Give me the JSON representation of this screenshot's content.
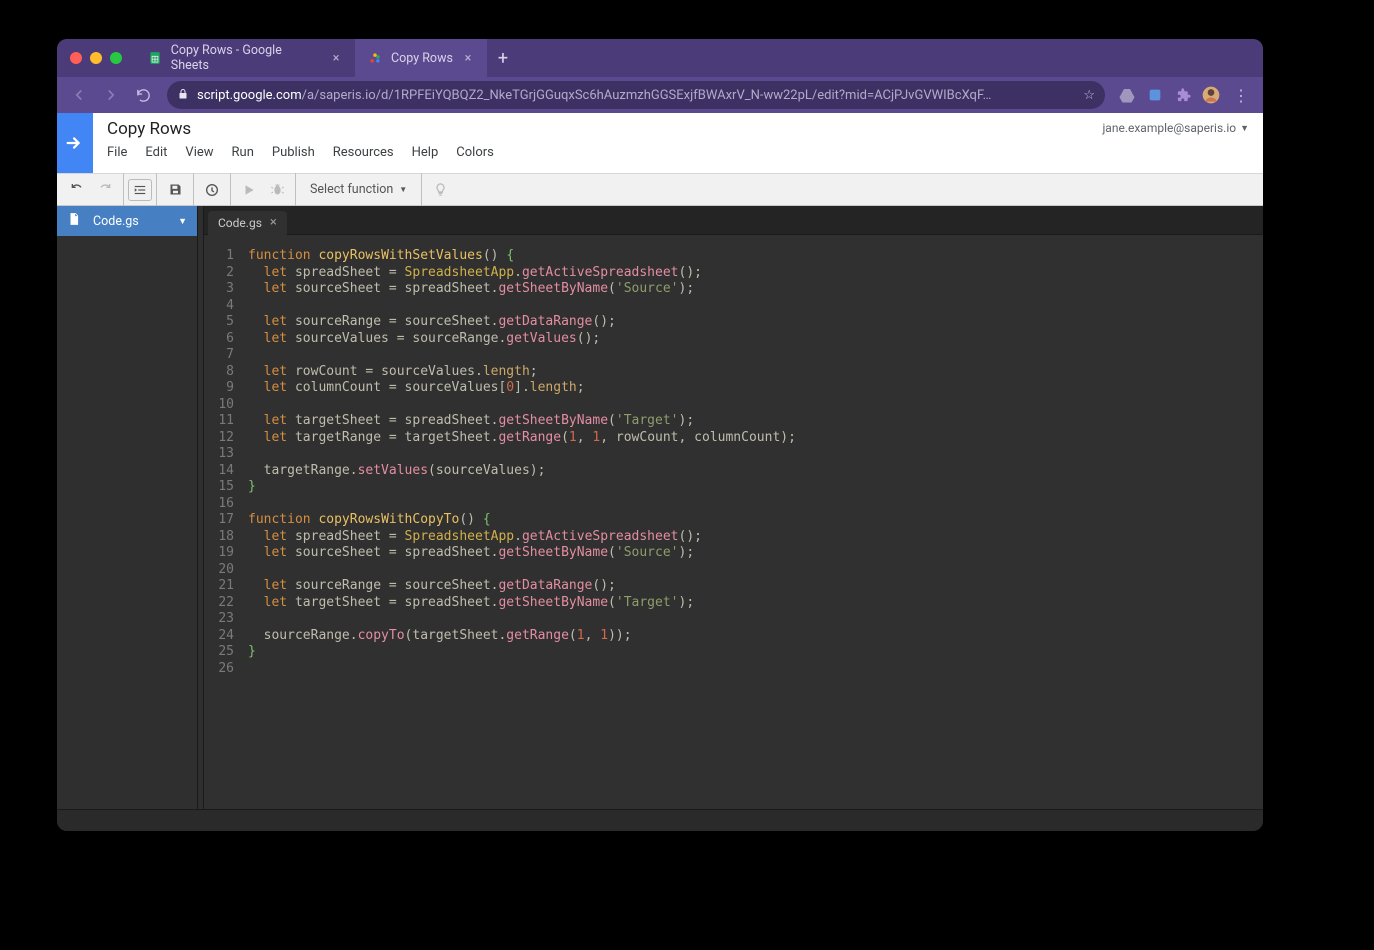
{
  "browser": {
    "tabs": [
      {
        "label": "Copy Rows - Google Sheets",
        "active": false,
        "icon": "sheets"
      },
      {
        "label": "Copy Rows",
        "active": true,
        "icon": "apps-script"
      }
    ],
    "url_host": "script.google.com",
    "url_path": "/a/saperis.io/d/1RPFEiYQBQZ2_NkeTGrjGGuqxSc6hAuzmzhGGSExjfBWAxrV_N-ww22pL/edit?mid=ACjPJvGVWIBcXqF…"
  },
  "app": {
    "title": "Copy Rows",
    "account": "jane.example@saperis.io",
    "menu": [
      "File",
      "Edit",
      "View",
      "Run",
      "Publish",
      "Resources",
      "Help",
      "Colors"
    ],
    "select_function": "Select function"
  },
  "files": {
    "items": [
      {
        "name": "Code.gs"
      }
    ]
  },
  "editor_tab": "Code.gs",
  "code": {
    "lines": [
      {
        "n": 1,
        "t": [
          [
            "kw",
            "function"
          ],
          [
            "punc",
            " "
          ],
          [
            "def",
            "copyRowsWithSetValues"
          ],
          [
            "punc",
            "()"
          ],
          [
            "punc",
            " "
          ],
          [
            "brace",
            "{"
          ]
        ]
      },
      {
        "n": 2,
        "t": [
          [
            "punc",
            "  "
          ],
          [
            "kw",
            "let"
          ],
          [
            "punc",
            " "
          ],
          [
            "var",
            "spreadSheet"
          ],
          [
            "punc",
            " = "
          ],
          [
            "obj",
            "SpreadsheetApp"
          ],
          [
            "punc",
            "."
          ],
          [
            "mthd",
            "getActiveSpreadsheet"
          ],
          [
            "punc",
            "();"
          ]
        ]
      },
      {
        "n": 3,
        "t": [
          [
            "punc",
            "  "
          ],
          [
            "kw",
            "let"
          ],
          [
            "punc",
            " "
          ],
          [
            "var",
            "sourceSheet"
          ],
          [
            "punc",
            " = "
          ],
          [
            "var",
            "spreadSheet"
          ],
          [
            "punc",
            "."
          ],
          [
            "mthd",
            "getSheetByName"
          ],
          [
            "punc",
            "("
          ],
          [
            "str",
            "'Source'"
          ],
          [
            "punc",
            ");"
          ]
        ]
      },
      {
        "n": 4,
        "t": []
      },
      {
        "n": 5,
        "t": [
          [
            "punc",
            "  "
          ],
          [
            "kw",
            "let"
          ],
          [
            "punc",
            " "
          ],
          [
            "var",
            "sourceRange"
          ],
          [
            "punc",
            " = "
          ],
          [
            "var",
            "sourceSheet"
          ],
          [
            "punc",
            "."
          ],
          [
            "mthd",
            "getDataRange"
          ],
          [
            "punc",
            "();"
          ]
        ]
      },
      {
        "n": 6,
        "t": [
          [
            "punc",
            "  "
          ],
          [
            "kw",
            "let"
          ],
          [
            "punc",
            " "
          ],
          [
            "var",
            "sourceValues"
          ],
          [
            "punc",
            " = "
          ],
          [
            "var",
            "sourceRange"
          ],
          [
            "punc",
            "."
          ],
          [
            "mthd",
            "getValues"
          ],
          [
            "punc",
            "();"
          ]
        ]
      },
      {
        "n": 7,
        "t": []
      },
      {
        "n": 8,
        "t": [
          [
            "punc",
            "  "
          ],
          [
            "kw",
            "let"
          ],
          [
            "punc",
            " "
          ],
          [
            "var",
            "rowCount"
          ],
          [
            "punc",
            " = "
          ],
          [
            "var",
            "sourceValues"
          ],
          [
            "punc",
            "."
          ],
          [
            "prop",
            "length"
          ],
          [
            "punc",
            ";"
          ]
        ]
      },
      {
        "n": 9,
        "t": [
          [
            "punc",
            "  "
          ],
          [
            "kw",
            "let"
          ],
          [
            "punc",
            " "
          ],
          [
            "var",
            "columnCount"
          ],
          [
            "punc",
            " = "
          ],
          [
            "var",
            "sourceValues"
          ],
          [
            "punc",
            "["
          ],
          [
            "num",
            "0"
          ],
          [
            "punc",
            "]."
          ],
          [
            "prop",
            "length"
          ],
          [
            "punc",
            ";"
          ]
        ]
      },
      {
        "n": 10,
        "t": []
      },
      {
        "n": 11,
        "t": [
          [
            "punc",
            "  "
          ],
          [
            "kw",
            "let"
          ],
          [
            "punc",
            " "
          ],
          [
            "var",
            "targetSheet"
          ],
          [
            "punc",
            " = "
          ],
          [
            "var",
            "spreadSheet"
          ],
          [
            "punc",
            "."
          ],
          [
            "mthd",
            "getSheetByName"
          ],
          [
            "punc",
            "("
          ],
          [
            "str",
            "'Target'"
          ],
          [
            "punc",
            ");"
          ]
        ]
      },
      {
        "n": 12,
        "t": [
          [
            "punc",
            "  "
          ],
          [
            "kw",
            "let"
          ],
          [
            "punc",
            " "
          ],
          [
            "var",
            "targetRange"
          ],
          [
            "punc",
            " = "
          ],
          [
            "var",
            "targetSheet"
          ],
          [
            "punc",
            "."
          ],
          [
            "mthd",
            "getRange"
          ],
          [
            "punc",
            "("
          ],
          [
            "num",
            "1"
          ],
          [
            "punc",
            ", "
          ],
          [
            "num",
            "1"
          ],
          [
            "punc",
            ", "
          ],
          [
            "var",
            "rowCount"
          ],
          [
            "punc",
            ", "
          ],
          [
            "var",
            "columnCount"
          ],
          [
            "punc",
            ");"
          ]
        ]
      },
      {
        "n": 13,
        "t": []
      },
      {
        "n": 14,
        "t": [
          [
            "punc",
            "  "
          ],
          [
            "var",
            "targetRange"
          ],
          [
            "punc",
            "."
          ],
          [
            "mthd",
            "setValues"
          ],
          [
            "punc",
            "("
          ],
          [
            "var",
            "sourceValues"
          ],
          [
            "punc",
            ");"
          ]
        ]
      },
      {
        "n": 15,
        "t": [
          [
            "brace",
            "}"
          ]
        ]
      },
      {
        "n": 16,
        "t": []
      },
      {
        "n": 17,
        "t": [
          [
            "kw",
            "function"
          ],
          [
            "punc",
            " "
          ],
          [
            "def",
            "copyRowsWithCopyTo"
          ],
          [
            "punc",
            "()"
          ],
          [
            "punc",
            " "
          ],
          [
            "brace",
            "{"
          ]
        ]
      },
      {
        "n": 18,
        "t": [
          [
            "punc",
            "  "
          ],
          [
            "kw",
            "let"
          ],
          [
            "punc",
            " "
          ],
          [
            "var",
            "spreadSheet"
          ],
          [
            "punc",
            " = "
          ],
          [
            "obj",
            "SpreadsheetApp"
          ],
          [
            "punc",
            "."
          ],
          [
            "mthd",
            "getActiveSpreadsheet"
          ],
          [
            "punc",
            "();"
          ]
        ]
      },
      {
        "n": 19,
        "t": [
          [
            "punc",
            "  "
          ],
          [
            "kw",
            "let"
          ],
          [
            "punc",
            " "
          ],
          [
            "var",
            "sourceSheet"
          ],
          [
            "punc",
            " = "
          ],
          [
            "var",
            "spreadSheet"
          ],
          [
            "punc",
            "."
          ],
          [
            "mthd",
            "getSheetByName"
          ],
          [
            "punc",
            "("
          ],
          [
            "str",
            "'Source'"
          ],
          [
            "punc",
            ");"
          ]
        ]
      },
      {
        "n": 20,
        "t": []
      },
      {
        "n": 21,
        "t": [
          [
            "punc",
            "  "
          ],
          [
            "kw",
            "let"
          ],
          [
            "punc",
            " "
          ],
          [
            "var",
            "sourceRange"
          ],
          [
            "punc",
            " = "
          ],
          [
            "var",
            "sourceSheet"
          ],
          [
            "punc",
            "."
          ],
          [
            "mthd",
            "getDataRange"
          ],
          [
            "punc",
            "();"
          ]
        ]
      },
      {
        "n": 22,
        "t": [
          [
            "punc",
            "  "
          ],
          [
            "kw",
            "let"
          ],
          [
            "punc",
            " "
          ],
          [
            "var",
            "targetSheet"
          ],
          [
            "punc",
            " = "
          ],
          [
            "var",
            "spreadSheet"
          ],
          [
            "punc",
            "."
          ],
          [
            "mthd",
            "getSheetByName"
          ],
          [
            "punc",
            "("
          ],
          [
            "str",
            "'Target'"
          ],
          [
            "punc",
            ");"
          ]
        ]
      },
      {
        "n": 23,
        "t": []
      },
      {
        "n": 24,
        "t": [
          [
            "punc",
            "  "
          ],
          [
            "var",
            "sourceRange"
          ],
          [
            "punc",
            "."
          ],
          [
            "mthd",
            "copyTo"
          ],
          [
            "punc",
            "("
          ],
          [
            "var",
            "targetSheet"
          ],
          [
            "punc",
            "."
          ],
          [
            "mthd",
            "getRange"
          ],
          [
            "punc",
            "("
          ],
          [
            "num",
            "1"
          ],
          [
            "punc",
            ", "
          ],
          [
            "num",
            "1"
          ],
          [
            "punc",
            "));"
          ]
        ]
      },
      {
        "n": 25,
        "t": [
          [
            "brace",
            "}"
          ]
        ]
      },
      {
        "n": 26,
        "t": []
      }
    ]
  }
}
